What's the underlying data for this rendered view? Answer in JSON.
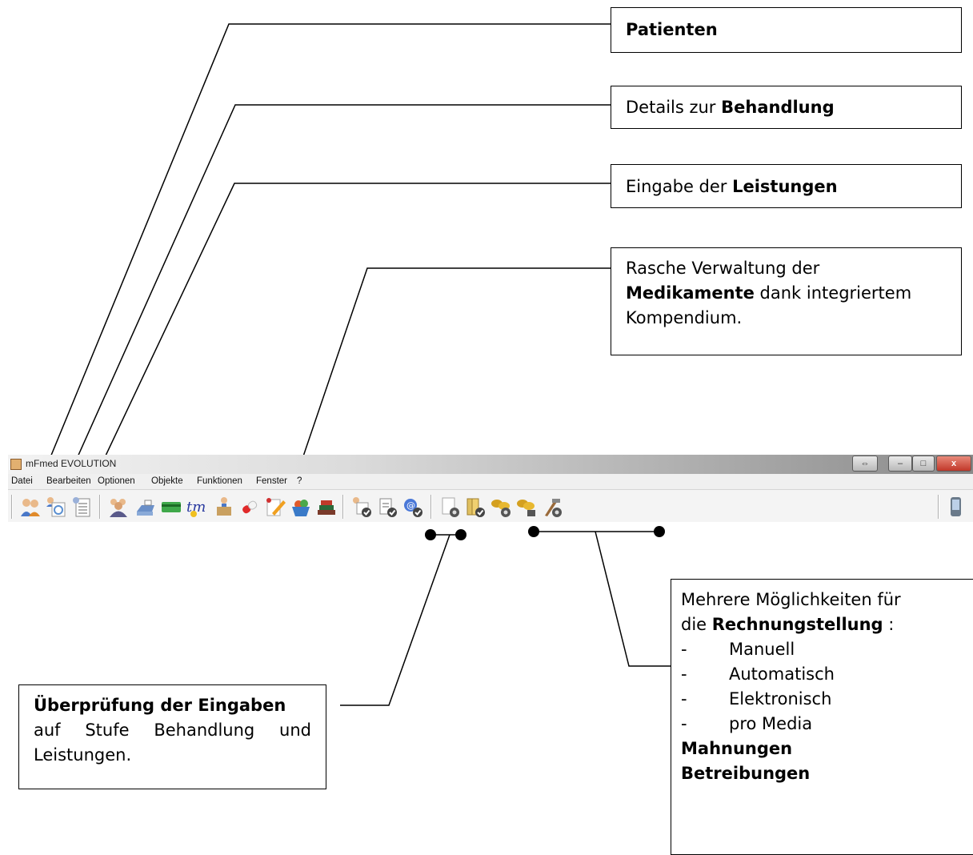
{
  "window": {
    "title": "mFmed EVOLUTION",
    "controls": {
      "restore": "⇔",
      "minimize": "–",
      "maximize": "□",
      "close": "x"
    }
  },
  "menu": [
    "Datei",
    "Bearbeiten",
    "Optionen",
    "Objekte",
    "Funktionen",
    "Fenster",
    "?"
  ],
  "toolbar_icons": [
    "patients-icon",
    "treatment-details-icon",
    "services-entry-icon",
    "group-patients-icon",
    "cash-register-icon",
    "card-icon",
    "tm-icon",
    "delivery-icon",
    "medication-pill-icon",
    "notes-edit-icon",
    "basket-icon",
    "books-icon",
    "check-treatment-icon",
    "check-services-icon",
    "check-email-icon",
    "invoice-manual-icon",
    "invoice-folder-icon",
    "coins-auto-icon",
    "coins-hand-icon",
    "tools-icon",
    "mobile-device-icon"
  ],
  "callouts": {
    "patienten": {
      "bold": "Patienten"
    },
    "behandlung": {
      "prefix": "Details zur ",
      "bold": "Behandlung"
    },
    "leistungen": {
      "prefix": "Eingabe der ",
      "bold": "Leistungen"
    },
    "medikamente": {
      "line1": "Rasche Verwaltung der",
      "bold": "Medikamente",
      "suffix": " dank integriertem",
      "line3": "Kompendium."
    },
    "ueberpruefung": {
      "bold": "Überprüfung der Eingaben",
      "rest": "auf Stufe Behandlung und Leistungen."
    },
    "rechnung": {
      "line1": "Mehrere Möglichkeiten für",
      "prefix2": "die ",
      "bold2": "Rechnungstellung",
      "suffix2": " :",
      "bullets": [
        "Manuell",
        "Automatisch",
        "Elektronisch",
        "pro Media"
      ],
      "bold_lines": [
        "Mahnungen",
        "Betreibungen"
      ]
    }
  }
}
